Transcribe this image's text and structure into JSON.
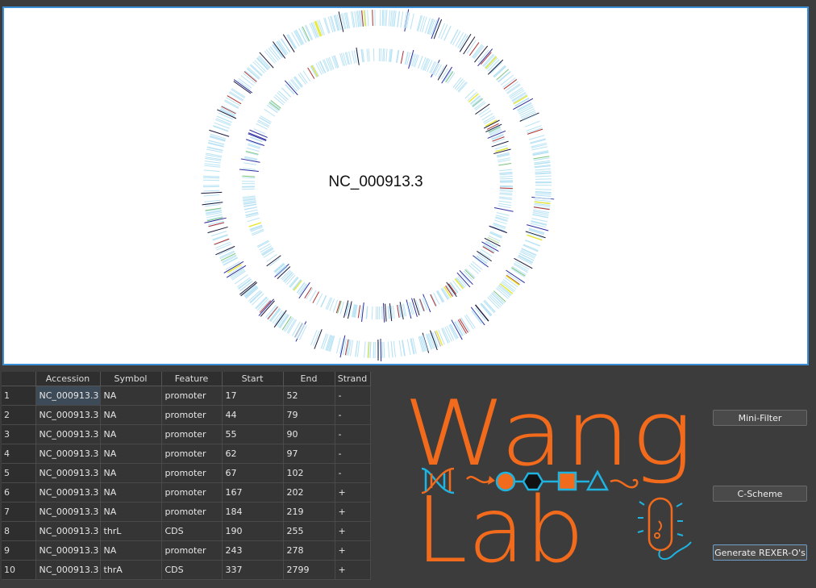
{
  "genome_map": {
    "accession": "NC_000913.3",
    "tracks": [
      "outer",
      "inner"
    ],
    "colors": {
      "background": "#ffffff",
      "border": "#3b8fd6",
      "feature_light": "#b9e3f4",
      "feature_dark": "#1a1a3c",
      "feature_blue": "#2c2ca0",
      "feature_red": "#b03030",
      "feature_yellow": "#e8e83a",
      "feature_green": "#7cc47c"
    }
  },
  "table": {
    "columns": [
      "Accession",
      "Symbol",
      "Feature",
      "Start",
      "End",
      "Strand"
    ],
    "rows": [
      {
        "n": "1",
        "accession": "NC_000913.3",
        "symbol": "NA",
        "feature": "promoter",
        "start": "17",
        "end": "52",
        "strand": "-"
      },
      {
        "n": "2",
        "accession": "NC_000913.3",
        "symbol": "NA",
        "feature": "promoter",
        "start": "44",
        "end": "79",
        "strand": "-"
      },
      {
        "n": "3",
        "accession": "NC_000913.3",
        "symbol": "NA",
        "feature": "promoter",
        "start": "55",
        "end": "90",
        "strand": "-"
      },
      {
        "n": "4",
        "accession": "NC_000913.3",
        "symbol": "NA",
        "feature": "promoter",
        "start": "62",
        "end": "97",
        "strand": "-"
      },
      {
        "n": "5",
        "accession": "NC_000913.3",
        "symbol": "NA",
        "feature": "promoter",
        "start": "67",
        "end": "102",
        "strand": "-"
      },
      {
        "n": "6",
        "accession": "NC_000913.3",
        "symbol": "NA",
        "feature": "promoter",
        "start": "167",
        "end": "202",
        "strand": "+"
      },
      {
        "n": "7",
        "accession": "NC_000913.3",
        "symbol": "NA",
        "feature": "promoter",
        "start": "184",
        "end": "219",
        "strand": "+"
      },
      {
        "n": "8",
        "accession": "NC_000913.3",
        "symbol": "thrL",
        "feature": "CDS",
        "start": "190",
        "end": "255",
        "strand": "+"
      },
      {
        "n": "9",
        "accession": "NC_000913.3",
        "symbol": "NA",
        "feature": "promoter",
        "start": "243",
        "end": "278",
        "strand": "+"
      },
      {
        "n": "10",
        "accession": "NC_000913.3",
        "symbol": "thrA",
        "feature": "CDS",
        "start": "337",
        "end": "2799",
        "strand": "+"
      }
    ]
  },
  "buttons": {
    "mini_filter": "Mini-Filter",
    "c_scheme": "C-Scheme",
    "generate": "Generate REXER-O's"
  },
  "logo": {
    "line1": "Wang",
    "line2": "Lab",
    "orange": "#f26a1b",
    "cyan": "#1fb3e0",
    "icons": [
      "dna-icon",
      "arrow-icon",
      "circle-icon",
      "hexagon-icon",
      "square-icon",
      "triangle-icon",
      "bacterium-icon"
    ]
  }
}
